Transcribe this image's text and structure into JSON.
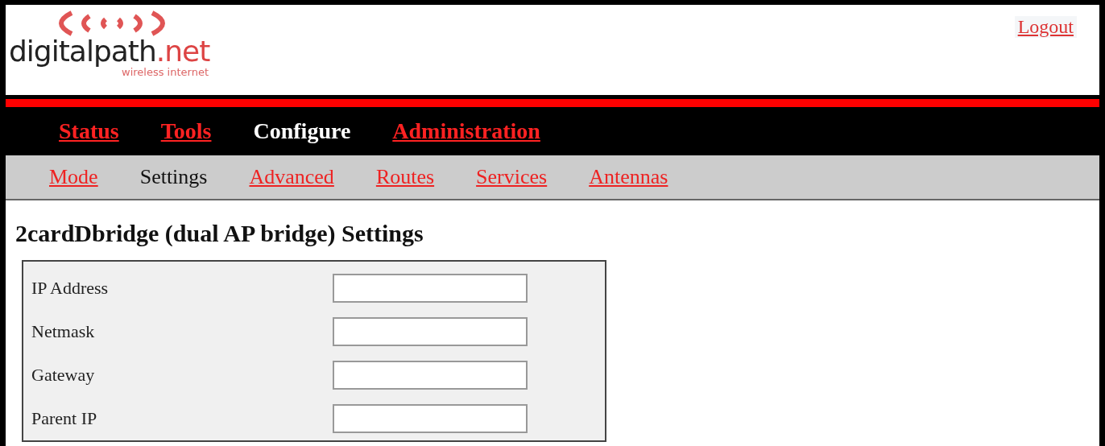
{
  "header": {
    "logo": {
      "name": "digitalpath",
      "suffix": ".net",
      "tagline": "wireless internet"
    },
    "logout": "Logout"
  },
  "nav": [
    {
      "label": "Status",
      "selected": false
    },
    {
      "label": "Tools",
      "selected": false
    },
    {
      "label": "Configure",
      "selected": true
    },
    {
      "label": "Administration",
      "selected": false
    }
  ],
  "subnav": [
    {
      "label": "Mode",
      "selected": false
    },
    {
      "label": "Settings",
      "selected": true
    },
    {
      "label": "Advanced",
      "selected": false
    },
    {
      "label": "Routes",
      "selected": false
    },
    {
      "label": "Services",
      "selected": false
    },
    {
      "label": "Antennas",
      "selected": false
    }
  ],
  "heading": "2cardDbridge (dual AP bridge) Settings",
  "fields": [
    {
      "label": "IP Address"
    },
    {
      "label": "Netmask"
    },
    {
      "label": "Gateway"
    },
    {
      "label": "Parent IP"
    }
  ]
}
